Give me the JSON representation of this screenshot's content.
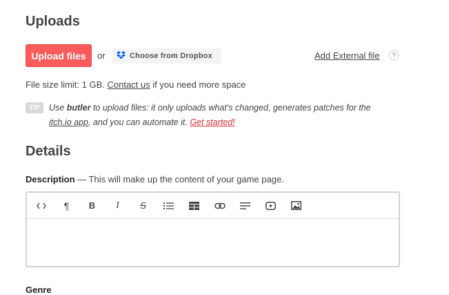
{
  "uploads": {
    "title": "Uploads",
    "upload_button": "Upload files",
    "or_text": "or",
    "dropbox_button": "Choose from Dropbox",
    "external_file_link": "Add External file",
    "help_glyph": "?",
    "size_limit_prefix": "File size limit: 1 GB.",
    "contact_link": "Contact us",
    "size_limit_suffix": "if you need more space"
  },
  "tip": {
    "badge": "TIP",
    "use": "Use",
    "butler": "butler",
    "line1_rest": "to upload files: it only uploads what's changed, generates patches for the",
    "itch_link": "itch.io app",
    "line2_mid": ", and you can automate it.",
    "get_started_link": "Get started!"
  },
  "details": {
    "title": "Details",
    "description_label": "Description",
    "description_hint": "— This will make up the content of your game page.",
    "genre_label": "Genre"
  },
  "toolbar": {
    "buttons": [
      {
        "name": "code-view-button",
        "icon": "code-icon",
        "glyph": "<>"
      },
      {
        "name": "paragraph-button",
        "icon": "pilcrow-icon",
        "glyph": "¶"
      },
      {
        "name": "bold-button",
        "icon": "bold-icon",
        "glyph": "B"
      },
      {
        "name": "italic-button",
        "icon": "italic-icon",
        "glyph": "I"
      },
      {
        "name": "strikethrough-button",
        "icon": "strikethrough-icon",
        "glyph": "S"
      },
      {
        "name": "bullet-list-button",
        "icon": "bullet-list-icon",
        "glyph": ""
      },
      {
        "name": "table-button",
        "icon": "table-icon",
        "glyph": ""
      },
      {
        "name": "link-button",
        "icon": "link-icon",
        "glyph": ""
      },
      {
        "name": "align-button",
        "icon": "align-left-icon",
        "glyph": ""
      },
      {
        "name": "video-button",
        "icon": "video-icon",
        "glyph": ""
      },
      {
        "name": "image-button",
        "icon": "image-icon",
        "glyph": ""
      }
    ]
  },
  "colors": {
    "accent": "#fa5c5c",
    "link_red": "#da2c2c",
    "dropbox_blue": "#0061fe"
  }
}
